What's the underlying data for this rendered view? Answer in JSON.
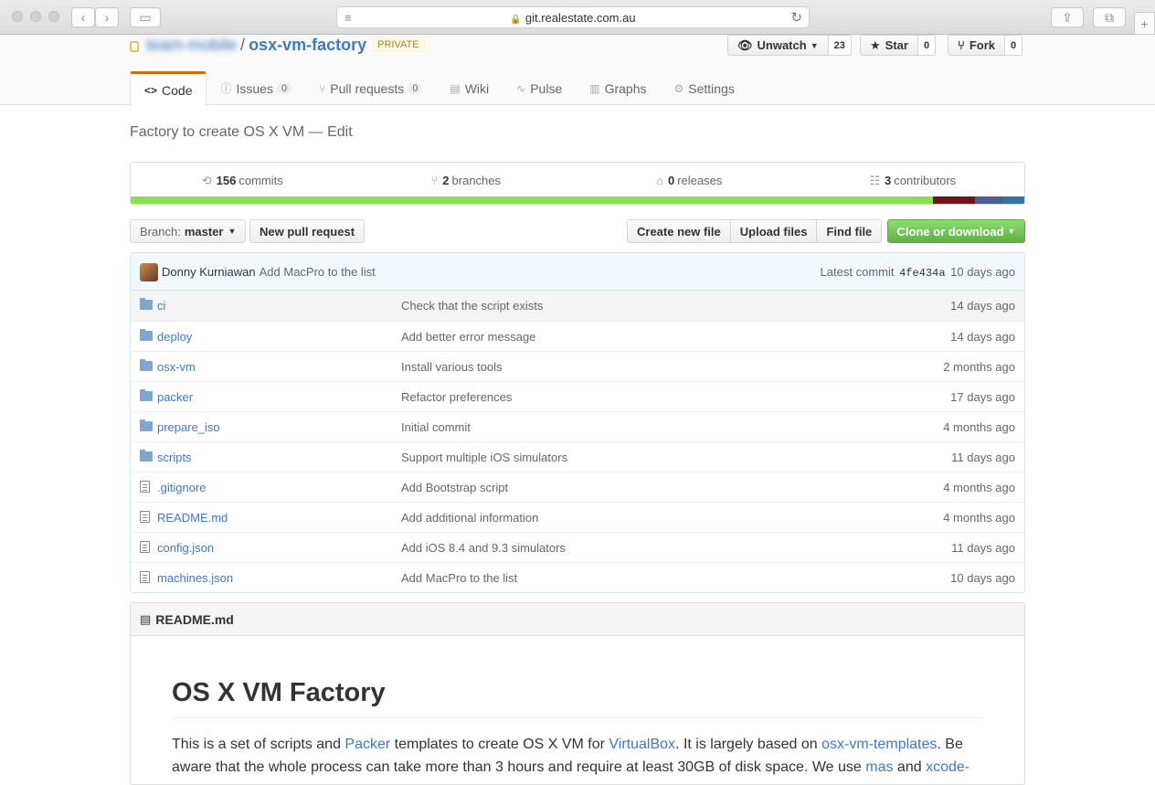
{
  "browser": {
    "url": "git.realestate.com.au"
  },
  "repo": {
    "owner": "team-mobile",
    "separator": "/",
    "name": "osx-vm-factory",
    "visibility": "PRIVATE",
    "watch_label": "Unwatch",
    "watch_count": "23",
    "star_label": "Star",
    "star_count": "0",
    "fork_label": "Fork",
    "fork_count": "0"
  },
  "tabs": [
    {
      "label": "Code",
      "icon": "code-icon",
      "selected": true
    },
    {
      "label": "Issues",
      "count": "0",
      "icon": "issue-icon"
    },
    {
      "label": "Pull requests",
      "count": "0",
      "icon": "pull-request-icon"
    },
    {
      "label": "Wiki",
      "icon": "book-icon"
    },
    {
      "label": "Pulse",
      "icon": "pulse-icon"
    },
    {
      "label": "Graphs",
      "icon": "graph-icon"
    },
    {
      "label": "Settings",
      "icon": "gear-icon"
    }
  ],
  "description": {
    "text": "Factory to create OS X VM",
    "dash": "—",
    "edit_label": "Edit"
  },
  "summary": {
    "commits_count": "156",
    "commits_label": "commits",
    "branches_count": "2",
    "branches_label": "branches",
    "releases_count": "0",
    "releases_label": "releases",
    "contributors_count": "3",
    "contributors_label": "contributors",
    "language_colors": [
      "#89e051",
      "#701516",
      "#4f5d95",
      "#3572a5"
    ],
    "language_shares": [
      0.898,
      0.047,
      0.03,
      0.025
    ]
  },
  "file_nav": {
    "branch_prefix": "Branch:",
    "branch_name": "master",
    "new_pr_label": "New pull request",
    "create_file_label": "Create new file",
    "upload_files_label": "Upload files",
    "find_file_label": "Find file",
    "clone_label": "Clone or download"
  },
  "commit_tease": {
    "author": "Donny Kurniawan",
    "message": "Add MacPro to the list",
    "latest_label": "Latest commit",
    "sha": "4fe434a",
    "age": "10 days ago"
  },
  "files": [
    {
      "name": "ci",
      "type": "dir",
      "message": "Check that the script exists",
      "age": "14 days ago"
    },
    {
      "name": "deploy",
      "type": "dir",
      "message": "Add better error message",
      "age": "14 days ago"
    },
    {
      "name": "osx-vm",
      "type": "dir",
      "message": "Install various tools",
      "age": "2 months ago"
    },
    {
      "name": "packer",
      "type": "dir",
      "message": "Refactor preferences",
      "age": "17 days ago"
    },
    {
      "name": "prepare_iso",
      "type": "dir",
      "message": "Initial commit",
      "age": "4 months ago"
    },
    {
      "name": "scripts",
      "type": "dir",
      "message": "Support multiple iOS simulators",
      "age": "11 days ago"
    },
    {
      "name": ".gitignore",
      "type": "file",
      "message": "Add Bootstrap script",
      "age": "4 months ago"
    },
    {
      "name": "README.md",
      "type": "file",
      "message": "Add additional information",
      "age": "4 months ago"
    },
    {
      "name": "config.json",
      "type": "file",
      "message": "Add iOS 8.4 and 9.3 simulators",
      "age": "11 days ago"
    },
    {
      "name": "machines.json",
      "type": "file",
      "message": "Add MacPro to the list",
      "age": "10 days ago"
    }
  ],
  "readme": {
    "header": "README.md",
    "title": "OS X VM Factory",
    "p1": "This is a set of scripts and ",
    "link_packer": "Packer",
    "p2": " templates to create OS X VM for ",
    "link_virtualbox": "VirtualBox",
    "p3": ". It is largely based on ",
    "link_templates": "osx-vm-templates",
    "p4": ". Be aware that the whole process can take more than 3 hours and require at least 30GB of disk space. We use ",
    "link_mas": "mas",
    "p5": " and ",
    "link_xcode": "xcode-"
  }
}
